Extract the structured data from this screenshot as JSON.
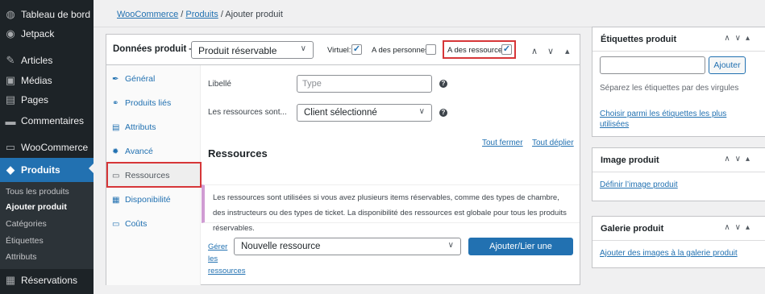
{
  "sidebar": {
    "items": [
      {
        "icon": "dashboard-icon",
        "glyph": "◍",
        "label": "Tableau de bord"
      },
      {
        "icon": "jetpack-icon",
        "glyph": "◉",
        "label": "Jetpack"
      },
      {
        "icon": "pin-icon",
        "glyph": "✎",
        "label": "Articles"
      },
      {
        "icon": "media-icon",
        "glyph": "▣",
        "label": "Médias"
      },
      {
        "icon": "pages-icon",
        "glyph": "▤",
        "label": "Pages"
      },
      {
        "icon": "comments-icon",
        "glyph": "▬",
        "label": "Commentaires"
      },
      {
        "icon": "woocommerce-icon",
        "glyph": "▭",
        "label": "WooCommerce"
      },
      {
        "icon": "products-icon",
        "glyph": "◆",
        "label": "Produits"
      },
      {
        "icon": "calendar-icon",
        "glyph": "▦",
        "label": "Réservations"
      }
    ],
    "submenu": [
      "Tous les produits",
      "Ajouter produit",
      "Catégories",
      "Étiquettes",
      "Attributs"
    ]
  },
  "breadcrumb": {
    "woocommerce": "WooCommerce",
    "sep1": "/",
    "produits": "Produits",
    "sep2": "/",
    "current": "Ajouter produit"
  },
  "product_data": {
    "title": "Données produit —",
    "type_value": "Produit réservable",
    "virtual_label": "Virtuel:",
    "virtual_checked": "✓",
    "persons_label": "A des personnes:",
    "resources_label": "A des ressources:",
    "resources_checked": "✓",
    "tabs": [
      {
        "icon": "wrench-icon",
        "glyph": "✒",
        "label": "Général"
      },
      {
        "icon": "link-icon",
        "glyph": "⚭",
        "label": "Produits liés"
      },
      {
        "icon": "list-icon",
        "glyph": "▤",
        "label": "Attributs"
      },
      {
        "icon": "gear-icon",
        "glyph": "✹",
        "label": "Avancé"
      },
      {
        "icon": "resource-icon",
        "glyph": "▭",
        "label": "Ressources"
      },
      {
        "icon": "calendar-icon",
        "glyph": "▦",
        "label": "Disponibilité"
      },
      {
        "icon": "cost-icon",
        "glyph": "▭",
        "label": "Coûts"
      }
    ],
    "label_field": {
      "label": "Libellé",
      "placeholder": "Type"
    },
    "resources_are": {
      "label": "Les ressources sont...",
      "value": "Client sélectionné"
    },
    "help": "?",
    "close_all": "Tout fermer",
    "expand_all": "Tout déplier",
    "section_title": "Ressources",
    "notice_text": "Les ressources sont utilisées si vous avez plusieurs items réservables, comme des types de chambre, des instructeurs ou des types de ticket. La disponibilité des ressources est globale pour tous les produits réservables.",
    "manage_links": [
      "Gérer",
      "les",
      "ressources"
    ],
    "new_resource_value": "Nouvelle ressource",
    "add_resource_button": "Ajouter/Lier une ressource"
  },
  "tags_box": {
    "title": "Étiquettes produit",
    "add_button": "Ajouter",
    "hint": "Séparez les étiquettes par des virgules",
    "choose_link": "Choisir parmi les étiquettes les plus utilisées"
  },
  "image_box": {
    "title": "Image produit",
    "link": "Définir l’image produit"
  },
  "gallery_box": {
    "title": "Galerie produit",
    "link": "Ajouter des images à la galerie produit"
  },
  "controls": {
    "up": "∧",
    "down": "∨",
    "toggle": "▴"
  },
  "colors": {
    "accent": "#2271b1",
    "highlight": "#d63638",
    "sidebar": "#1d2327"
  }
}
